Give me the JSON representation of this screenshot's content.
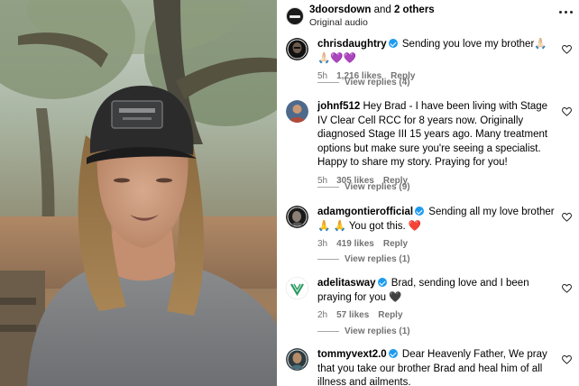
{
  "header": {
    "account": "3doorsdown",
    "and_text": " and ",
    "others": "2 others",
    "subtitle": "Original audio"
  },
  "comments": [
    {
      "username": "chrisdaughtry",
      "verified": true,
      "text": "Sending you love my brother🙏🏻🙏🏻💜💜",
      "time": "5h",
      "likes": "1,216 likes",
      "reply": "Reply",
      "replies": "View replies (4)"
    },
    {
      "username": "johnf512",
      "verified": false,
      "text": "Hey Brad - I have been living with Stage IV Clear Cell RCC for 8 years now. Originally diagnosed Stage III 15 years ago. Many treatment options but make sure you're seeing a specialist. Happy to share my story. Praying for you!",
      "time": "5h",
      "likes": "305 likes",
      "reply": "Reply",
      "replies": "View replies (9)"
    },
    {
      "username": "adamgontierofficial",
      "verified": true,
      "text": "Sending all my love brother 🙏 🙏 You got this. ❤️",
      "time": "3h",
      "likes": "419 likes",
      "reply": "Reply",
      "replies": "View replies (1)"
    },
    {
      "username": "adelitasway",
      "verified": true,
      "text": "Brad, sending love and I been praying for you 🖤",
      "time": "2h",
      "likes": "57 likes",
      "reply": "Reply",
      "replies": "View replies (1)"
    },
    {
      "username": "tommyvext2.0",
      "verified": true,
      "text": "Dear Heavenly Father, We pray that you take our brother Brad and heal him of all illness and ailments.",
      "time": "",
      "likes": "",
      "reply": "",
      "replies": ""
    }
  ],
  "icons": {
    "more": "more-horizontal-icon",
    "like": "heart-outline-icon"
  },
  "colors": {
    "meta_gray": "#737373",
    "verified_blue": "#1d9bf0",
    "link_black": "#000000"
  }
}
